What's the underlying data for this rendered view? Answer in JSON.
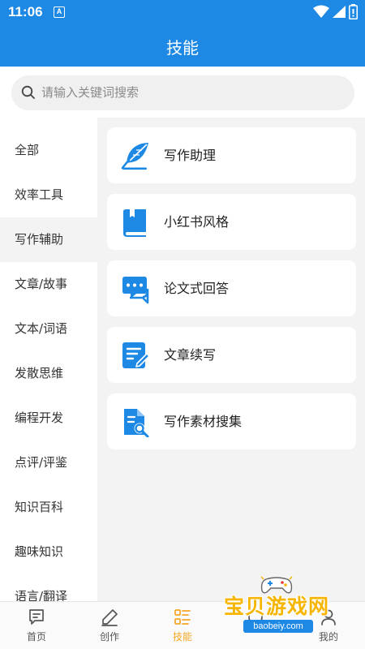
{
  "status": {
    "time": "11:06",
    "notification_icon": "A"
  },
  "page": {
    "title": "技能"
  },
  "search": {
    "placeholder": "请输入关键词搜索"
  },
  "sidebar": {
    "items": [
      {
        "label": "全部"
      },
      {
        "label": "效率工具"
      },
      {
        "label": "写作辅助"
      },
      {
        "label": "文章/故事"
      },
      {
        "label": "文本/词语"
      },
      {
        "label": "发散思维"
      },
      {
        "label": "编程开发"
      },
      {
        "label": "点评/评鉴"
      },
      {
        "label": "知识百科"
      },
      {
        "label": "趣味知识"
      },
      {
        "label": "语言/翻译"
      }
    ],
    "selected": "写作辅助"
  },
  "cards": [
    {
      "label": "写作助理",
      "icon": "feather-icon"
    },
    {
      "label": "小红书风格",
      "icon": "book-icon"
    },
    {
      "label": "论文式回答",
      "icon": "chat-bubble-icon"
    },
    {
      "label": "文章续写",
      "icon": "edit-document-icon"
    },
    {
      "label": "写作素材搜集",
      "icon": "document-search-icon"
    }
  ],
  "tabbar": {
    "tabs": [
      {
        "label": "首页",
        "icon": "message-square-icon"
      },
      {
        "label": "创作",
        "icon": "pen-icon"
      },
      {
        "label": "技能",
        "icon": "grid-list-icon"
      },
      {
        "label": "",
        "icon": "fourth-tab-icon"
      },
      {
        "label": "我的",
        "icon": "user-icon"
      }
    ],
    "active": "技能"
  },
  "watermark": {
    "text": "宝贝游戏网",
    "url": "baobeiy.com"
  },
  "colors": {
    "primary": "#1e88e5",
    "active_tab": "#f5a623",
    "panel_bg": "#f3f3f3",
    "card_bg": "#ffffff"
  }
}
